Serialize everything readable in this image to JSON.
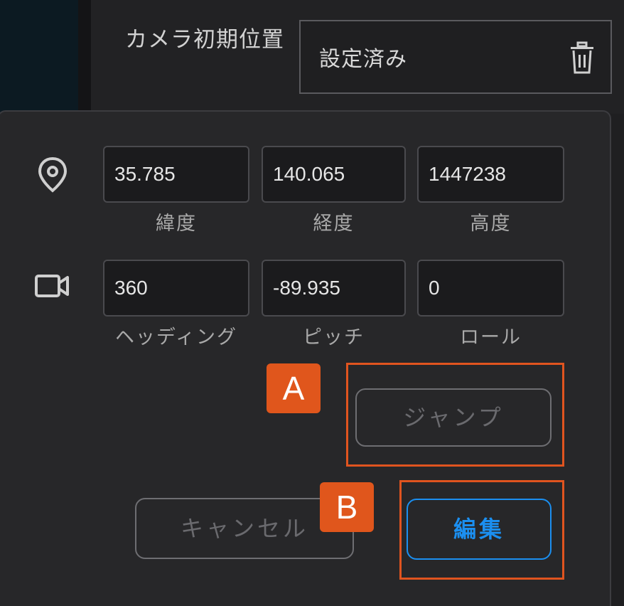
{
  "camera_initial_position": {
    "label": "カメラ初期位置",
    "status": "設定済み",
    "delete_icon": "trash-icon"
  },
  "position": {
    "icon": "location-pin-icon",
    "fields": [
      {
        "value": "35.785",
        "caption": "緯度"
      },
      {
        "value": "140.065",
        "caption": "経度"
      },
      {
        "value": "1447238",
        "caption": "高度"
      }
    ]
  },
  "orientation": {
    "icon": "video-camera-icon",
    "fields": [
      {
        "value": "360",
        "caption": "ヘッディング"
      },
      {
        "value": "-89.935",
        "caption": "ピッチ"
      },
      {
        "value": "0",
        "caption": "ロール"
      }
    ]
  },
  "buttons": {
    "jump": "ジャンプ",
    "cancel": "キャンセル",
    "edit": "編集"
  },
  "annotations": {
    "a": "A",
    "b": "B"
  },
  "colors": {
    "accent": "#1b8ff0",
    "annotation": "#e0541f",
    "panel": "#272729"
  }
}
